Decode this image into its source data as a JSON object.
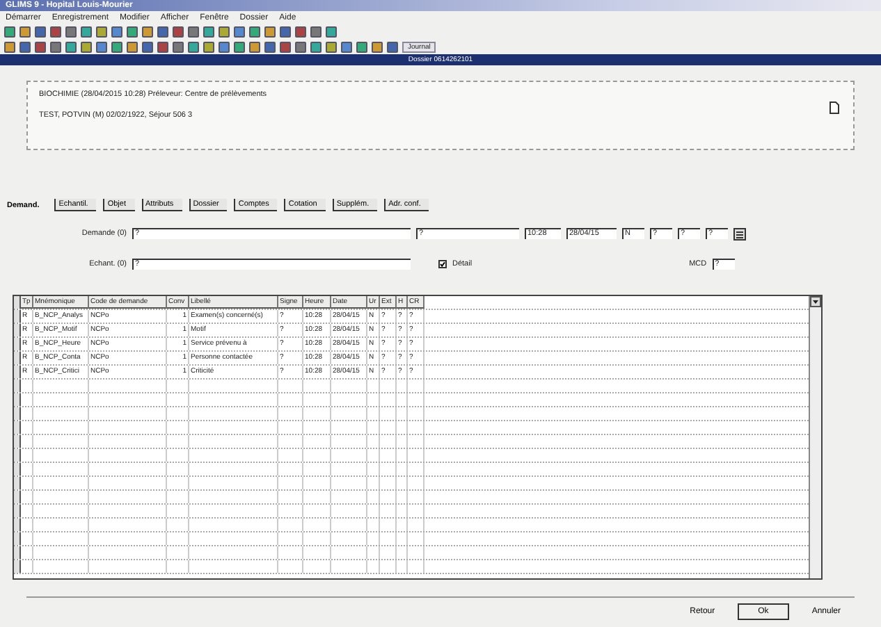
{
  "window": {
    "title": "GLIMS 9 - Hopital Louis-Mourier"
  },
  "menu": [
    "Démarrer",
    "Enregistrement",
    "Modifier",
    "Afficher",
    "Fenêtre",
    "Dossier",
    "Aide"
  ],
  "toolbar_rows": [
    {},
    {
      "label": "Journal"
    }
  ],
  "document_bar": {
    "title": "Dossier 0614262101"
  },
  "header": {
    "lines": [
      "BIOCHIMIE (28/04/2015 10:28) Préleveur: Centre de prélèvements",
      "TEST, POTVIN (M) 02/02/1922, Séjour 506 3"
    ]
  },
  "tabs": [
    {
      "label": "Demand.",
      "selected": true
    },
    {
      "label": "Echantil.",
      "selected": false
    },
    {
      "label": "Objet",
      "selected": false
    },
    {
      "label": "Attributs",
      "selected": false
    },
    {
      "label": "Dossier",
      "selected": false
    },
    {
      "label": "Comptes",
      "selected": false
    },
    {
      "label": "Cotation",
      "selected": false
    },
    {
      "label": "Supplém.",
      "selected": false
    },
    {
      "label": "Adr. conf.",
      "selected": false
    }
  ],
  "demande": {
    "label": "Demande (0)",
    "value": "?",
    "fields": [
      "?",
      "10:28",
      "28/04/15",
      "N",
      "?",
      "?",
      "?"
    ]
  },
  "echant": {
    "label": "Echant. (0)",
    "value": "?",
    "detail": {
      "label": "Détail",
      "checked": true
    },
    "mcd": {
      "label": "MCD",
      "value": "?"
    }
  },
  "table": {
    "columns": [
      "Tp",
      "Mnémonique",
      "Code de demande",
      "Conv",
      "Libellé",
      "Signe",
      "Heure",
      "Date",
      "Ur",
      "Ext",
      "H",
      "CR"
    ],
    "rows": [
      [
        "R",
        "B_NCP_Analys",
        "NCPo",
        "1",
        "Examen(s) concerné(s)",
        "?",
        "10:28",
        "28/04/15",
        "N",
        "?",
        "?",
        "?"
      ],
      [
        "R",
        "B_NCP_Motif",
        "NCPo",
        "1",
        "Motif",
        "?",
        "10:28",
        "28/04/15",
        "N",
        "?",
        "?",
        "?"
      ],
      [
        "R",
        "B_NCP_Heure",
        "NCPo",
        "1",
        "Service prévenu à",
        "?",
        "10:28",
        "28/04/15",
        "N",
        "?",
        "?",
        "?"
      ],
      [
        "R",
        "B_NCP_Conta",
        "NCPo",
        "1",
        "Personne contactée",
        "?",
        "10:28",
        "28/04/15",
        "N",
        "?",
        "?",
        "?"
      ],
      [
        "R",
        "B_NCP_Critici",
        "NCPo",
        "1",
        "Criticité",
        "?",
        "10:28",
        "28/04/15",
        "N",
        "?",
        "?",
        "?"
      ]
    ]
  },
  "buttons": [
    "Retour",
    "Ok",
    "Annuler"
  ]
}
